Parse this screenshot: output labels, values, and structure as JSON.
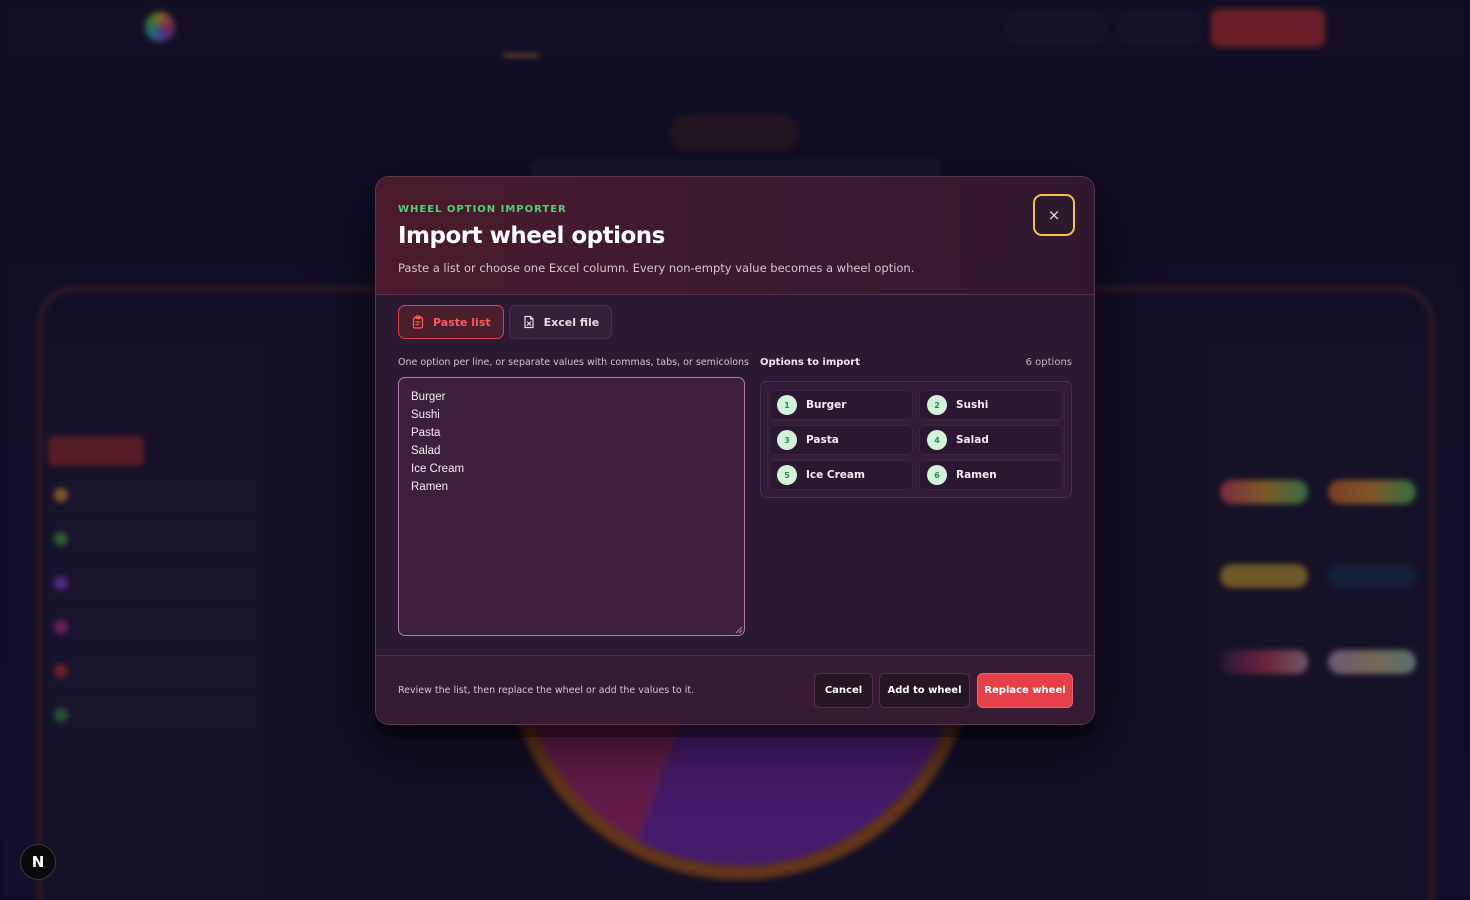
{
  "modal": {
    "eyebrow": "WHEEL OPTION IMPORTER",
    "title": "Import wheel options",
    "description": "Paste a list or choose one Excel column. Every non-empty value becomes a wheel option.",
    "close_glyph": "×",
    "close_icon": "close-icon"
  },
  "tabs": [
    {
      "label": "Paste list",
      "icon": "clipboard-icon",
      "active": true
    },
    {
      "label": "Excel file",
      "icon": "excel-file-icon",
      "active": false
    }
  ],
  "input": {
    "label": "One option per line, or separate values with commas, tabs, or semicolons",
    "value": "Burger\nSushi\nPasta\nSalad\nIce Cream\nRamen"
  },
  "preview": {
    "label": "Options to import",
    "count": "6 options",
    "items": [
      {
        "num": "1",
        "label": "Burger"
      },
      {
        "num": "2",
        "label": "Sushi"
      },
      {
        "num": "3",
        "label": "Pasta"
      },
      {
        "num": "4",
        "label": "Salad"
      },
      {
        "num": "5",
        "label": "Ice Cream"
      },
      {
        "num": "6",
        "label": "Ramen"
      }
    ]
  },
  "footer": {
    "hint": "Review the list, then replace the wheel or add the values to it.",
    "cancel": "Cancel",
    "add": "Add to wheel",
    "replace": "Replace wheel"
  },
  "badge": {
    "letter": "N"
  },
  "colors": {
    "accent_red": "#e5404a",
    "accent_green": "#4fd27a",
    "focus_ring": "#f2c44a",
    "modal_bg": "#2c1a32"
  }
}
